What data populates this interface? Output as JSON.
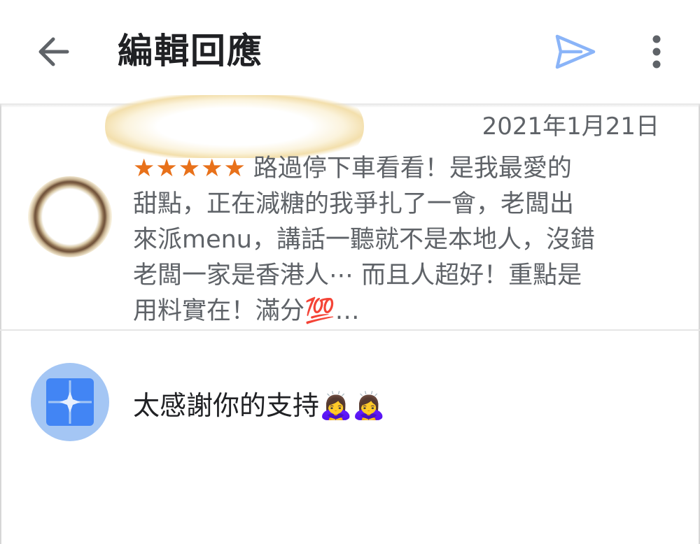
{
  "appbar": {
    "title": "編輯回應",
    "back_icon": "arrow-left-icon",
    "send_icon": "send-icon",
    "more_icon": "more-vert-icon",
    "accent_color": "#8ab4f8"
  },
  "review": {
    "date": "2021年1月21日",
    "rating": 5,
    "stars": "★★★★★",
    "star_color": "#e8711a",
    "lines": [
      "路過停下車看看！是我最愛的",
      "甜點，正在減糖的我爭扎了一會，老闆出",
      "來派menu，講話一聽就不是本地人，沒錯",
      "老闆一家是香港人⋯ 而且人超好！重點是",
      "用料實在！滿分💯…"
    ]
  },
  "reply": {
    "text": "太感謝你的支持🙇‍♀️🙇‍♀️",
    "avatar_color": "#a4c6f4",
    "logo_color": "#4285f4"
  }
}
